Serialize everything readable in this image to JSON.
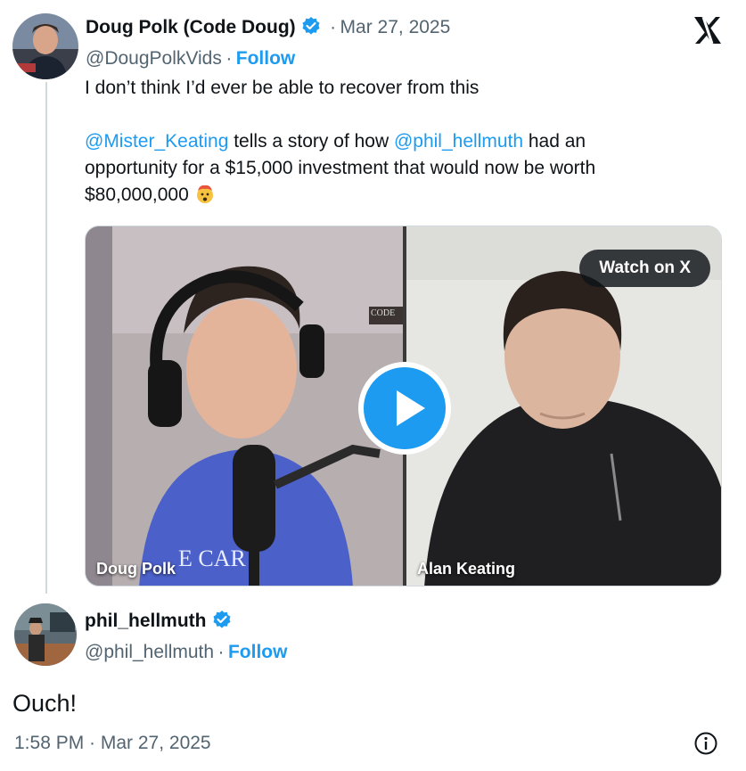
{
  "tweet": {
    "author_name": "Doug Polk (Code Doug)",
    "separator": "·",
    "date": "Mar 27, 2025",
    "handle": "@DougPolkVids",
    "follow_label": "Follow",
    "line1": "I don’t think I’d ever be able to recover from this",
    "mention1": "@Mister_Keating",
    "text2a": " tells a story of how ",
    "mention2": "@phil_hellmuth",
    "text2b": " had an",
    "line3": "opportunity for a $15,000 investment that would now be worth",
    "line4": "$80,000,000",
    "emoji_icon": "exploding-head-icon",
    "platform_icon": "x-logo-icon"
  },
  "video": {
    "watch_label": "Watch on X",
    "left_name": "Doug Polk",
    "right_name": "Alan Keating",
    "play_icon": "play-icon",
    "shirt_text": "E CAR",
    "sign_text": "CODE"
  },
  "reply": {
    "author_name": "phil_hellmuth",
    "handle": "@phil_hellmuth",
    "separator": "·",
    "follow_label": "Follow",
    "text": "Ouch!",
    "time": "1:58 PM · Mar 27, 2025",
    "info_icon": "info-icon"
  },
  "colors": {
    "accent": "#1d9bf0",
    "text": "#0f1419",
    "muted": "#536471"
  }
}
